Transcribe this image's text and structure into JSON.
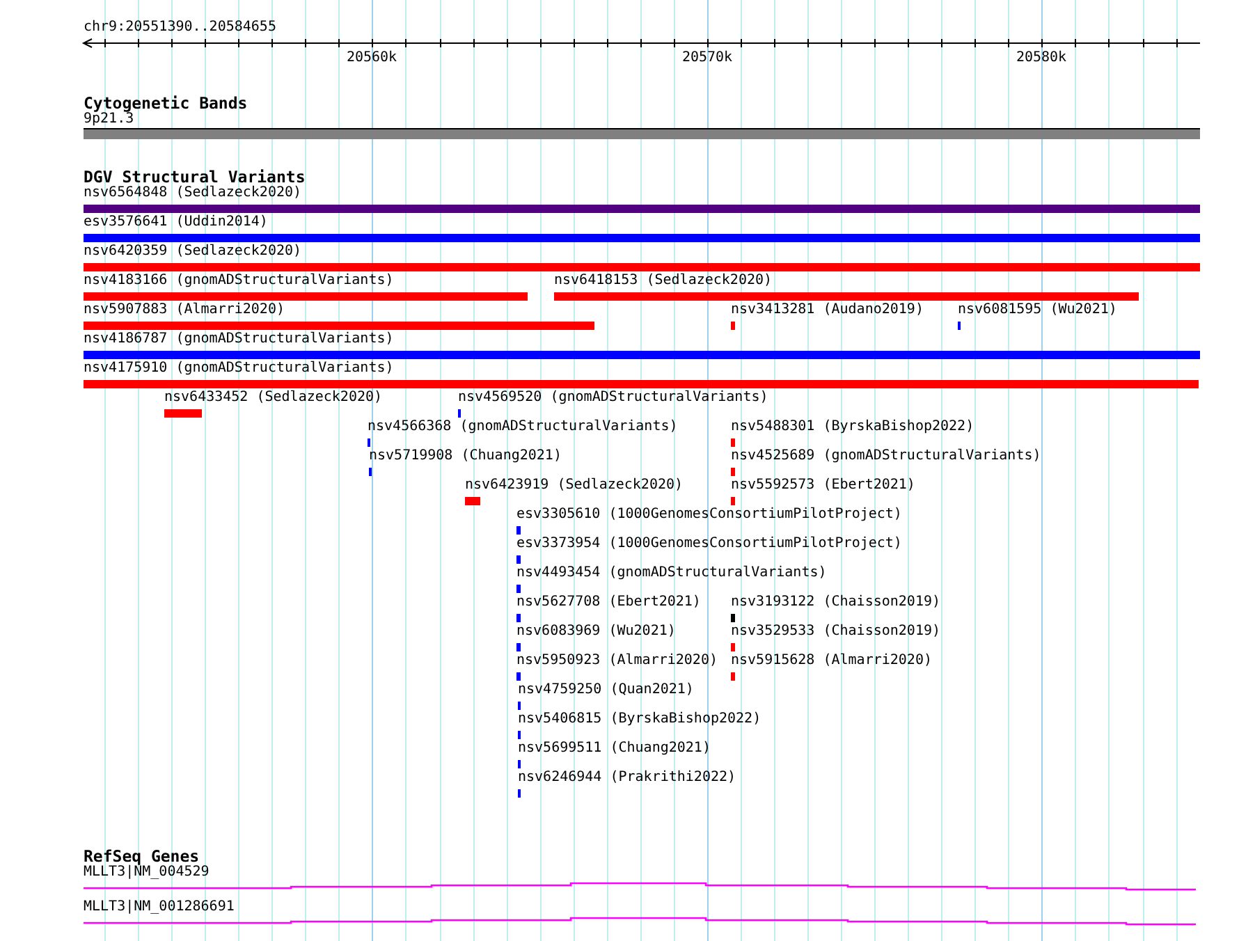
{
  "ruler": {
    "location": "chr9:20551390..20584655",
    "ticks": [
      "20560k",
      "20570k",
      "20580k"
    ]
  },
  "tracks": [
    {
      "kind": "bands",
      "title": "Cytogenetic Bands",
      "features": [
        {
          "label": "9p21.3"
        }
      ]
    },
    {
      "kind": "variants",
      "title": "DGV Structural Variants",
      "features": [
        {
          "label": "nsv6564848 (Sedlazeck2020)",
          "color": "#500080"
        },
        {
          "label": "esv3576641 (Uddin2014)",
          "color": "#0000ff"
        },
        {
          "label": "nsv6420359 (Sedlazeck2020)",
          "color": "#ff0000"
        },
        {
          "label": "nsv4183166 (gnomADStructuralVariants)",
          "color": "#ff0000"
        },
        {
          "label": "nsv6418153 (Sedlazeck2020)",
          "color": "#ff0000"
        },
        {
          "label": "nsv5907883 (Almarri2020)",
          "color": "#ff0000"
        },
        {
          "label": "nsv3413281 (Audano2019)",
          "color": "#ff0000"
        },
        {
          "label": "nsv6081595 (Wu2021)",
          "color": "#0000ff"
        },
        {
          "label": "nsv4186787 (gnomADStructuralVariants)",
          "color": "#0000ff"
        },
        {
          "label": "nsv4175910 (gnomADStructuralVariants)",
          "color": "#ff0000"
        },
        {
          "label": "nsv6433452 (Sedlazeck2020)",
          "color": "#ff0000"
        },
        {
          "label": "nsv4569520 (gnomADStructuralVariants)",
          "color": "#0000ff"
        },
        {
          "label": "nsv4566368 (gnomADStructuralVariants)",
          "color": "#0000ff"
        },
        {
          "label": "nsv5488301 (ByrskaBishop2022)",
          "color": "#ff0000"
        },
        {
          "label": "nsv5719908 (Chuang2021)",
          "color": "#0000ff"
        },
        {
          "label": "nsv4525689 (gnomADStructuralVariants)",
          "color": "#ff0000"
        },
        {
          "label": "nsv6423919 (Sedlazeck2020)",
          "color": "#ff0000"
        },
        {
          "label": "nsv5592573 (Ebert2021)",
          "color": "#ff0000"
        },
        {
          "label": "esv3305610 (1000GenomesConsortiumPilotProject)",
          "color": "#0000ff"
        },
        {
          "label": "esv3373954 (1000GenomesConsortiumPilotProject)",
          "color": "#0000ff"
        },
        {
          "label": "nsv4493454 (gnomADStructuralVariants)",
          "color": "#0000ff"
        },
        {
          "label": "nsv5627708 (Ebert2021)",
          "color": "#0000ff"
        },
        {
          "label": "nsv3193122 (Chaisson2019)",
          "color": "#000000"
        },
        {
          "label": "nsv6083969 (Wu2021)",
          "color": "#0000ff"
        },
        {
          "label": "nsv3529533 (Chaisson2019)",
          "color": "#ff0000"
        },
        {
          "label": "nsv5950923 (Almarri2020)",
          "color": "#0000ff"
        },
        {
          "label": "nsv5915628 (Almarri2020)",
          "color": "#ff0000"
        },
        {
          "label": "nsv4759250 (Quan2021)",
          "color": "#0000ff"
        },
        {
          "label": "nsv5406815 (ByrskaBishop2022)",
          "color": "#0000ff"
        },
        {
          "label": "nsv5699511 (Chuang2021)",
          "color": "#0000ff"
        },
        {
          "label": "nsv6246944 (Prakrithi2022)",
          "color": "#0000ff"
        }
      ]
    },
    {
      "kind": "genes",
      "title": "RefSeq Genes",
      "features": [
        {
          "label": "MLLT3|NM_004529"
        },
        {
          "label": "MLLT3|NM_001286691"
        }
      ]
    }
  ]
}
